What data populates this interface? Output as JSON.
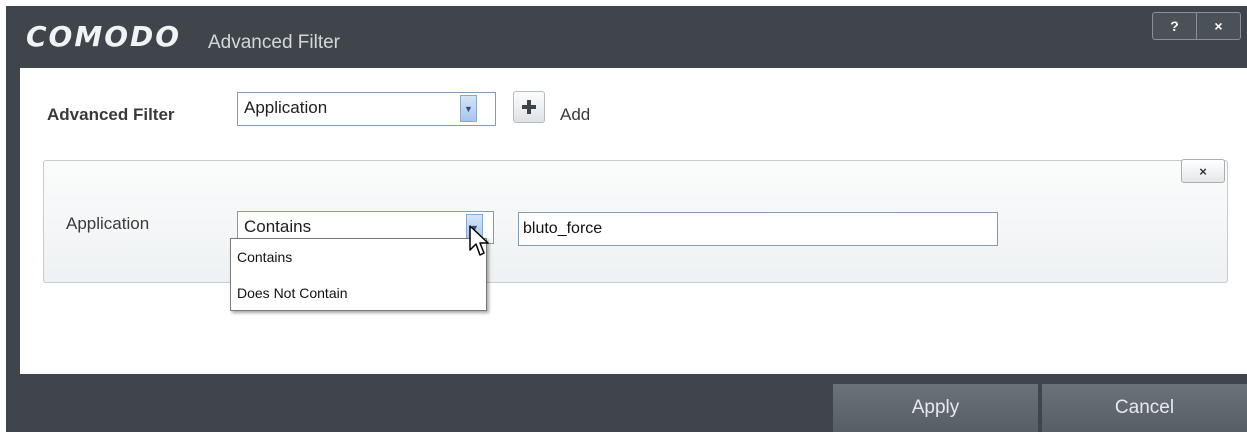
{
  "window": {
    "logo": "COMODO",
    "title": "Advanced Filter",
    "help_label": "?",
    "close_label": "×"
  },
  "filter": {
    "label": "Advanced Filter",
    "type_value": "Application",
    "add_label": "Add"
  },
  "condition": {
    "label": "Application",
    "operator_value": "Contains",
    "text_value": "bluto_force",
    "remove_label": "×",
    "operator_options": [
      "Contains",
      "Does Not Contain"
    ]
  },
  "actions": {
    "apply_label": "Apply",
    "cancel_label": "Cancel"
  },
  "colors": {
    "chrome": "#3f454b",
    "button": "#60676e",
    "combo_border": "#7f9db9",
    "combo_arrow": "#a9c4e9"
  },
  "icons": {
    "add": "plus-icon",
    "dropdown": "chevron-down-icon",
    "pointer": "mouse-cursor-icon"
  }
}
